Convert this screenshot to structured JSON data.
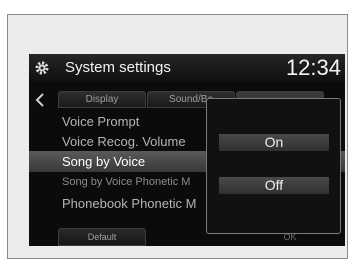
{
  "title_bar": {
    "title": "System settings",
    "clock": "12:34",
    "settings_icon": "gear-icon"
  },
  "tabs": [
    {
      "label": "Display"
    },
    {
      "label": "Sound/Be"
    }
  ],
  "back_icon": "chevron-left-icon",
  "settings_list": [
    {
      "label": "Voice Prompt"
    },
    {
      "label": "Voice Recog. Volume"
    },
    {
      "label": "Song by Voice",
      "selected": true
    },
    {
      "label": "Song by Voice Phonetic M"
    },
    {
      "label": "Phonebook Phonetic M"
    }
  ],
  "bottom_bar": {
    "default_label": "Default",
    "ok_label": "OK"
  },
  "popup": {
    "options": [
      {
        "label": "On"
      },
      {
        "label": "Off"
      }
    ]
  }
}
